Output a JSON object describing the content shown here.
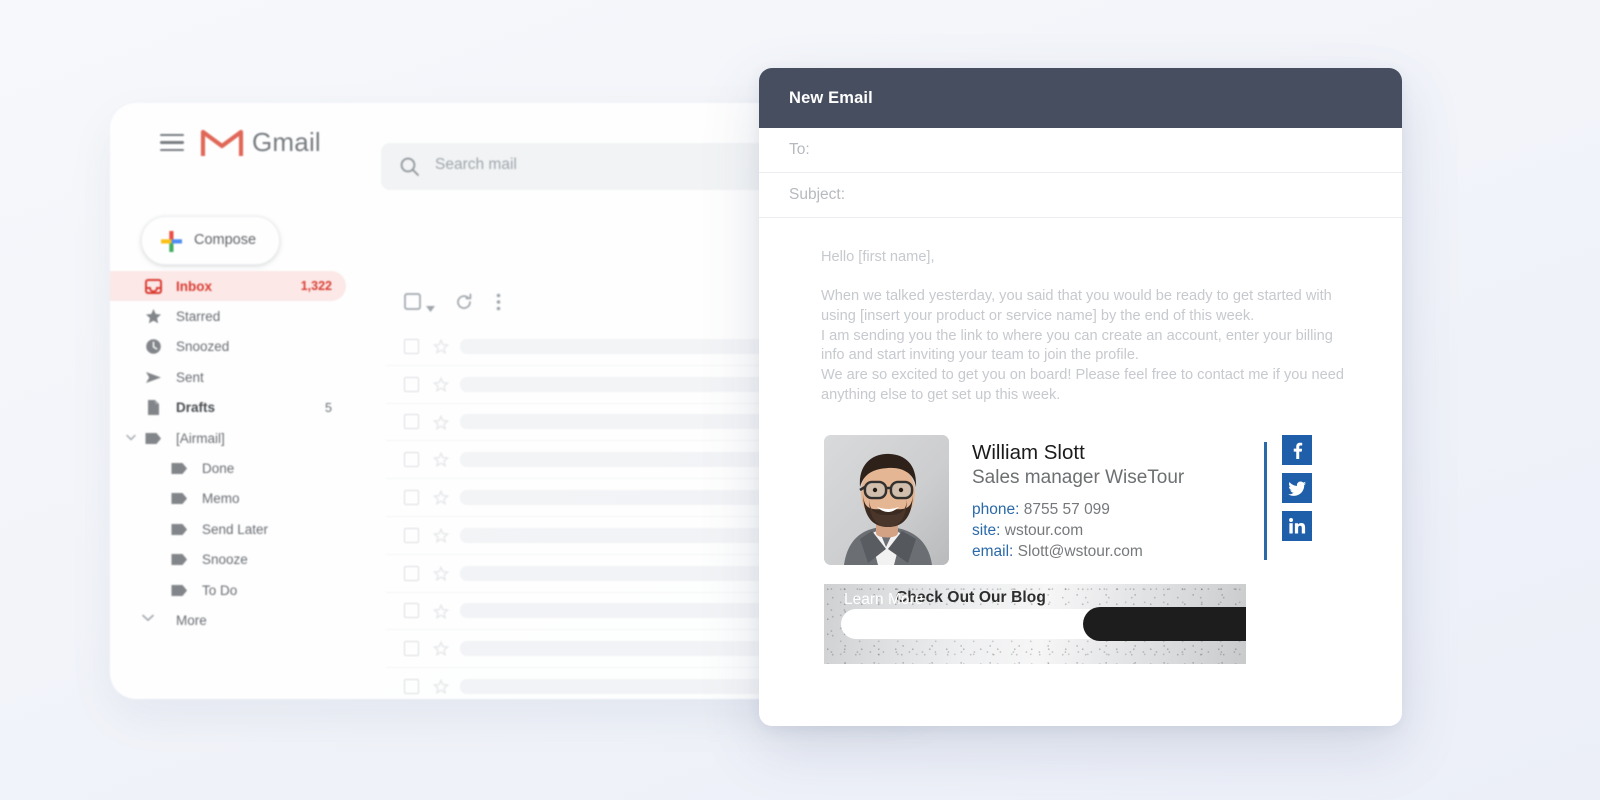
{
  "gmail": {
    "brand": "Gmail",
    "hamburger_icon": "hamburger-menu-icon",
    "logo_icon": "gmail-m-logo-icon",
    "search": {
      "placeholder": "Search mail",
      "icon": "search-icon"
    },
    "compose": {
      "label": "Compose",
      "icon": "plus-icon"
    },
    "toolbar": {
      "select_all_icon": "checkbox-icon",
      "select_all_dropdown_icon": "chevron-down-icon",
      "refresh_icon": "refresh-icon",
      "more_options_icon": "more-vertical-icon"
    },
    "sidebar": [
      {
        "label": "Inbox",
        "count": "1,322",
        "icon": "inbox-icon",
        "active": true,
        "indent": 0
      },
      {
        "label": "Starred",
        "count": "",
        "icon": "star-icon",
        "active": false,
        "indent": 0
      },
      {
        "label": "Snoozed",
        "count": "",
        "icon": "clock-icon",
        "active": false,
        "indent": 0
      },
      {
        "label": "Sent",
        "count": "",
        "icon": "send-icon",
        "active": false,
        "indent": 0
      },
      {
        "label": "Drafts",
        "count": "5",
        "icon": "draft-icon",
        "active": false,
        "indent": 0,
        "bold": true
      },
      {
        "label": "[Airmail]",
        "count": "",
        "icon": "label-icon",
        "active": false,
        "indent": 0,
        "caret": "expanded"
      },
      {
        "label": "Done",
        "count": "",
        "icon": "label-icon",
        "active": false,
        "indent": 1
      },
      {
        "label": "Memo",
        "count": "",
        "icon": "label-icon",
        "active": false,
        "indent": 1
      },
      {
        "label": "Send Later",
        "count": "",
        "icon": "label-icon",
        "active": false,
        "indent": 1
      },
      {
        "label": "Snooze",
        "count": "",
        "icon": "label-icon",
        "active": false,
        "indent": 1
      },
      {
        "label": "To Do",
        "count": "",
        "icon": "label-icon",
        "active": false,
        "indent": 1
      },
      {
        "label": "More",
        "count": "",
        "icon": "chevron-down-icon",
        "active": false,
        "indent": 0,
        "caret_only": true
      }
    ],
    "list_rows": 11,
    "colors": {
      "active_bg": "#fce8e6",
      "active_fg": "#d93025",
      "text": "#5f6368",
      "search_bg": "#f1f3f4"
    }
  },
  "compose": {
    "title": "New Email",
    "header_bg": "#474e5f",
    "to_label": "To:",
    "subject_label": "Subject:",
    "body": [
      "Hello [first name],",
      "",
      "When we talked yesterday, you said that you would be ready to get started with",
      "using [insert your product or service name] by the end of this week.",
      "I am sending you the link to where you can create an account, enter your billing",
      "info and start inviting your team to join the profile.",
      "We are so excited to get you on board! Please feel free to contact me if you need",
      "anything else to get set up this week."
    ],
    "signature": {
      "photo_alt": "portrait-photo-smiling-bearded-man-glasses-suit",
      "name": "William Slott",
      "role": "Sales manager WiseTour",
      "contacts": [
        {
          "key": "phone:",
          "value": "8755 57 099"
        },
        {
          "key": "site:",
          "value": "wstour.com"
        },
        {
          "key": "email:",
          "value": "Slott@wstour.com"
        }
      ],
      "accent_color": "#2a6aa8",
      "social": [
        {
          "name": "facebook-icon",
          "glyph": "f"
        },
        {
          "name": "twitter-icon",
          "glyph": "ᵗ"
        },
        {
          "name": "linkedin-icon",
          "glyph": "in"
        }
      ]
    },
    "banner": {
      "pill_text": "Check Out Our Blog",
      "cta_text": "Learn More",
      "cta_bg": "#1d1d1d"
    }
  }
}
